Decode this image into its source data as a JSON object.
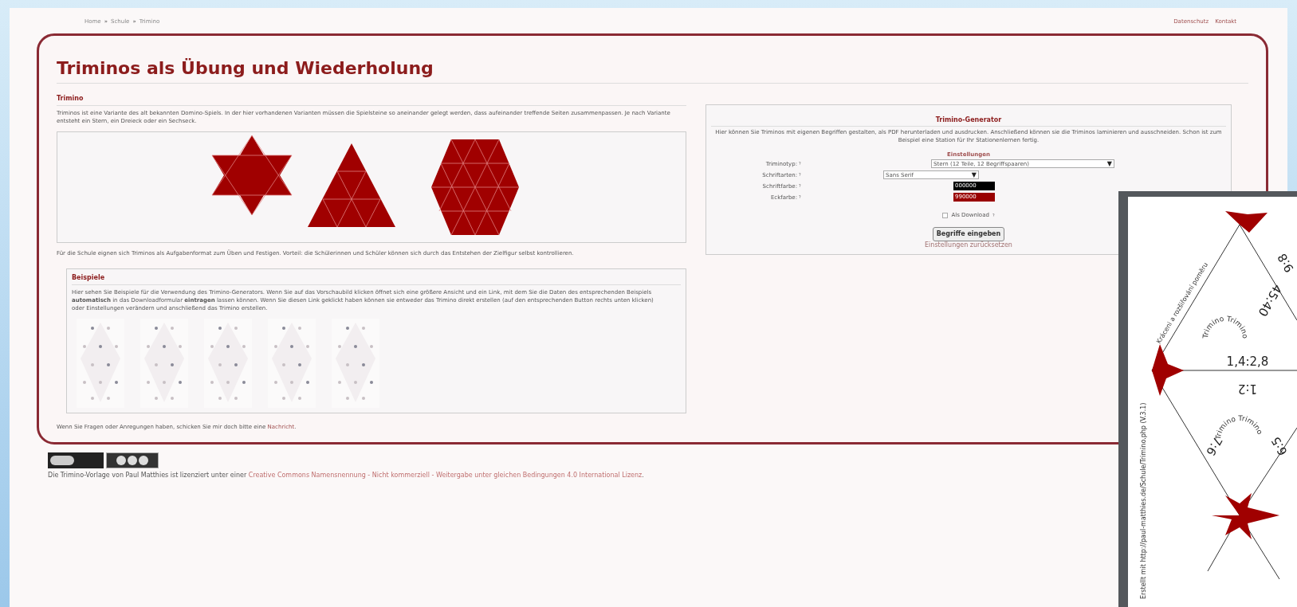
{
  "breadcrumb": [
    "Home",
    "Schule",
    "Trimino"
  ],
  "breadcrumb_separator": "»",
  "top_links": [
    "Datenschutz",
    "Kontakt"
  ],
  "title": "Triminos als Übung und Wiederholung",
  "intro": {
    "heading": "Trimino",
    "text": "Triminos ist eine Variante des alt bekannten Domino-Spiels. In der hier vorhandenen Varianten müssen die Spielsteine so aneinander gelegt werden, dass aufeinander treffende Seiten zusammenpassen. Je nach Variante entsteht ein Stern, ein Dreieck oder ein Sechseck.",
    "text2": "Für die Schule eignen sich Triminos als Aufgabenformat zum Üben und Festigen. Vorteil: die Schülerinnen und Schüler können sich durch das Entstehen der Zielfigur selbst kontrollieren."
  },
  "examples": {
    "heading": "Beispiele",
    "text": "Hier sehen Sie Beispiele für die Verwendung des Trimino-Generators. Wenn Sie auf das Vorschaubild klicken öffnet sich eine größere Ansicht und ein Link, mit dem Sie die Daten des entsprechenden Beispiels **automatisch** in das Downloadformular **eintragen** lassen können. Wenn Sie diesen Link geklickt haben können sie entweder das Trimino direkt erstellen (auf den entsprechenden Button rechts unten klicken) oder Einstellungen verändern und anschließend das Trimino erstellen."
  },
  "contact": {
    "text": "Wenn Sie Fragen oder Anregungen haben, schicken Sie mir doch bitte eine",
    "link": "Nachricht",
    "end": "."
  },
  "license": {
    "text": "Die Trimino-Vorlage von Paul Matthies ist lizenziert unter einer",
    "link": "Creative Commons Namensnennung - Nicht kommerziell - Weitergabe unter gleichen Bedingungen 4.0 International Lizenz",
    "end": "."
  },
  "generator": {
    "title": "Trimino-Generator",
    "text": "Hier können Sie Triminos mit eigenen Begriffen gestalten, als PDF herunterladen und ausdrucken. Anschließend können sie die Triminos laminieren und ausschneiden. Schon ist zum Beispiel eine Station für Ihr Stationenlernen fertig.",
    "settings_heading": "Einstellungen",
    "fields": [
      {
        "kind": "select",
        "label": "Triminotyp:",
        "mark": "?",
        "value": "Stern (12 Teile, 12 Begriffspaaren)",
        "caret": "▼"
      },
      {
        "kind": "select",
        "label": "Schriftarten:",
        "mark": "?",
        "value": "Sans Serif",
        "caret": "▼"
      },
      {
        "kind": "color",
        "label": "Schriftfarbe:",
        "mark": "?",
        "value": "000000",
        "color": "#000000"
      },
      {
        "kind": "color",
        "label": "Eckfarbe:",
        "mark": "?",
        "value": "990000",
        "color": "#990000"
      }
    ],
    "download": {
      "label": "Als Download",
      "mark": "?",
      "checked": false
    },
    "button": "Begriffe eingeben",
    "reset_link": "Einstellungen zurücksetzen"
  },
  "preview": {
    "labels": [
      {
        "text": "45:40"
      },
      {
        "text": "1,4:2,8"
      },
      {
        "text": "1:2"
      },
      {
        "text": "7:6"
      },
      {
        "text": "6:5"
      },
      {
        "text": "9:8"
      }
    ],
    "circle_texts": [
      "Trimino Trimino",
      "Trimino Trimino"
    ],
    "edge_text": "Kráceni a rozšiřování poměru",
    "credit": "Erstellt mit http://paul-matthies.de/Schule/Trimino.php (V.3.1)"
  }
}
